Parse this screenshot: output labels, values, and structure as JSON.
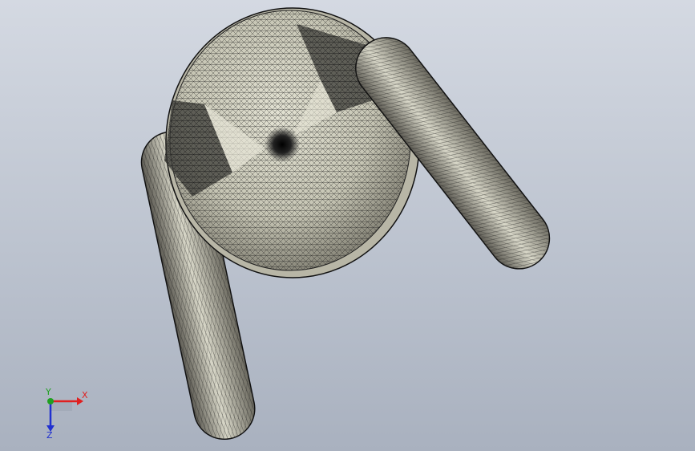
{
  "viewport": {
    "model": "mesh-model",
    "colors": {
      "background_top": "#d4d9e2",
      "background_bottom": "#a9b1bf",
      "mesh_fill": "#c9c8b8",
      "mesh_shadow": "#6e6c62",
      "mesh_line": "#1a1a1a"
    }
  },
  "triad": {
    "x_label": "X",
    "y_label": "Y",
    "z_label": "Z",
    "colors": {
      "x": "#e02020",
      "y": "#20a020",
      "z": "#2030d0"
    }
  }
}
